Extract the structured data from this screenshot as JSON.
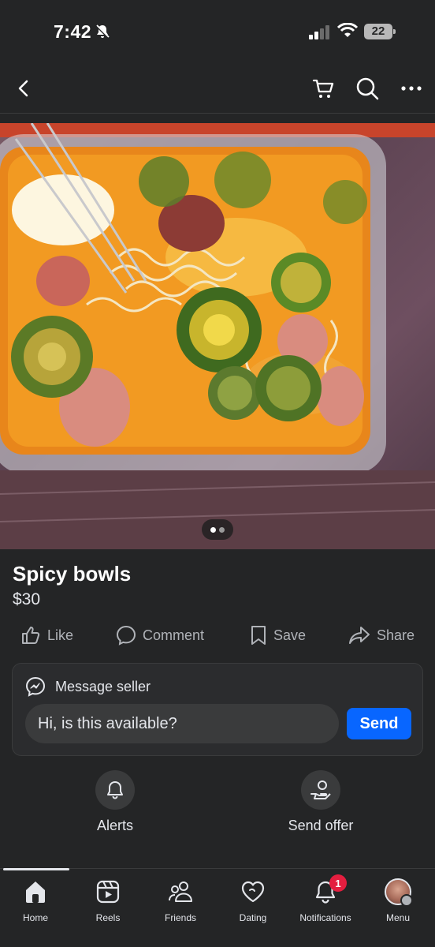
{
  "status_bar": {
    "time": "7:42",
    "battery": "22"
  },
  "listing": {
    "title": "Spicy bowls",
    "price": "$30",
    "photo_count": 2,
    "photo_index": 1
  },
  "actions": [
    {
      "label": "Like",
      "icon": "thumbs-up-icon"
    },
    {
      "label": "Comment",
      "icon": "comment-icon"
    },
    {
      "label": "Save",
      "icon": "bookmark-icon"
    },
    {
      "label": "Share",
      "icon": "share-icon"
    }
  ],
  "message": {
    "heading": "Message seller",
    "input_value": "Hi, is this available?",
    "send_label": "Send"
  },
  "quick_actions": [
    {
      "label": "Alerts",
      "icon": "bell-icon"
    },
    {
      "label": "Send offer",
      "icon": "send-offer-icon"
    }
  ],
  "tabs": [
    {
      "label": "Home",
      "icon": "home-icon",
      "active": true
    },
    {
      "label": "Reels",
      "icon": "reels-icon"
    },
    {
      "label": "Friends",
      "icon": "friends-icon"
    },
    {
      "label": "Dating",
      "icon": "dating-icon"
    },
    {
      "label": "Notifications",
      "icon": "bell-icon",
      "badge": "1"
    },
    {
      "label": "Menu",
      "icon": "avatar"
    }
  ],
  "colors": {
    "background": "#242526",
    "accent": "#0866ff",
    "badge": "#e41e3f",
    "muted": "#b0b3b8"
  }
}
